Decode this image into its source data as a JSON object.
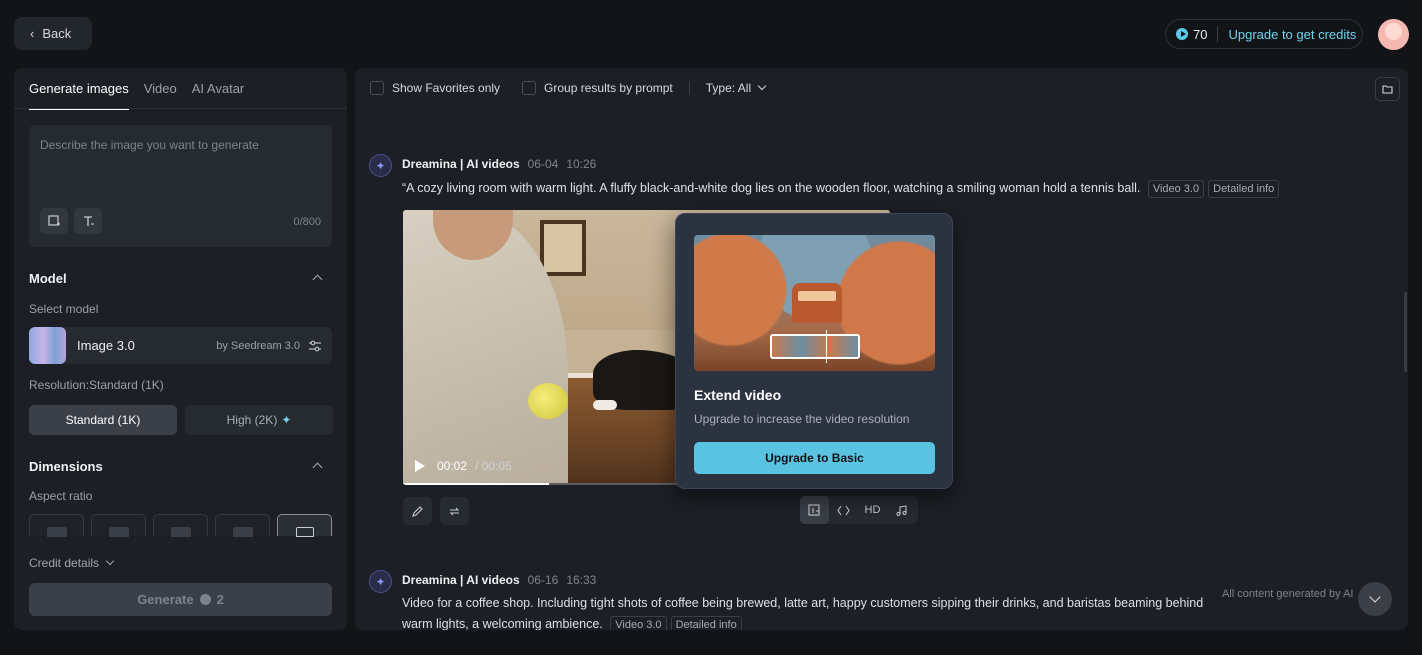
{
  "header": {
    "back_label": "Back",
    "credits_count": "70",
    "upgrade_label": "Upgrade to get credits"
  },
  "left_panel": {
    "tabs": [
      {
        "label": "Generate images",
        "active": true
      },
      {
        "label": "Video",
        "active": false
      },
      {
        "label": "AI Avatar",
        "active": false
      }
    ],
    "prompt": {
      "placeholder": "Describe the image you want to generate",
      "value": "",
      "char_count": "0/800"
    },
    "model_section": {
      "title": "Model",
      "select_label": "Select model",
      "model_name": "Image 3.0",
      "model_by": "by Seedream 3.0"
    },
    "resolution": {
      "label": "Resolution:Standard (1K)",
      "standard": "Standard (1K)",
      "high": "High (2K)"
    },
    "dimensions": {
      "title": "Dimensions",
      "aspect_label": "Aspect ratio"
    },
    "credit_details": "Credit details",
    "generate": {
      "label": "Generate",
      "cost": "2"
    }
  },
  "filters": {
    "favorites": "Show Favorites only",
    "group": "Group results by prompt",
    "type": "Type: All"
  },
  "posts": [
    {
      "author": "Dreamina | AI videos",
      "date": "06-04",
      "time": "10:26",
      "text": "“A cozy living room with warm light. A fluffy black-and-white dog lies on the wooden floor, watching a smiling woman hold a tennis ball.",
      "tags": [
        "Video 3.0",
        "Detailed info"
      ],
      "video": {
        "current": "00:02",
        "duration": "/ 00:05",
        "progress": 0.3
      },
      "tools": [
        "extend-icon",
        "interpolate-icon",
        "HD",
        "music-icon"
      ]
    },
    {
      "author": "Dreamina | AI videos",
      "date": "06-16",
      "time": "16:33",
      "text_line1": "Video for a coffee shop. Including tight shots of coffee being brewed, latte art, happy customers sipping their  drinks, and baristas beaming behind",
      "text_line2": "warm lights, a welcoming ambience.",
      "tags": [
        "Video 3.0",
        "Detailed info"
      ]
    }
  ],
  "popup": {
    "title": "Extend video",
    "subtitle": "Upgrade to increase the video resolution",
    "button": "Upgrade to Basic"
  },
  "disclaimer": "All content generated by AI"
}
